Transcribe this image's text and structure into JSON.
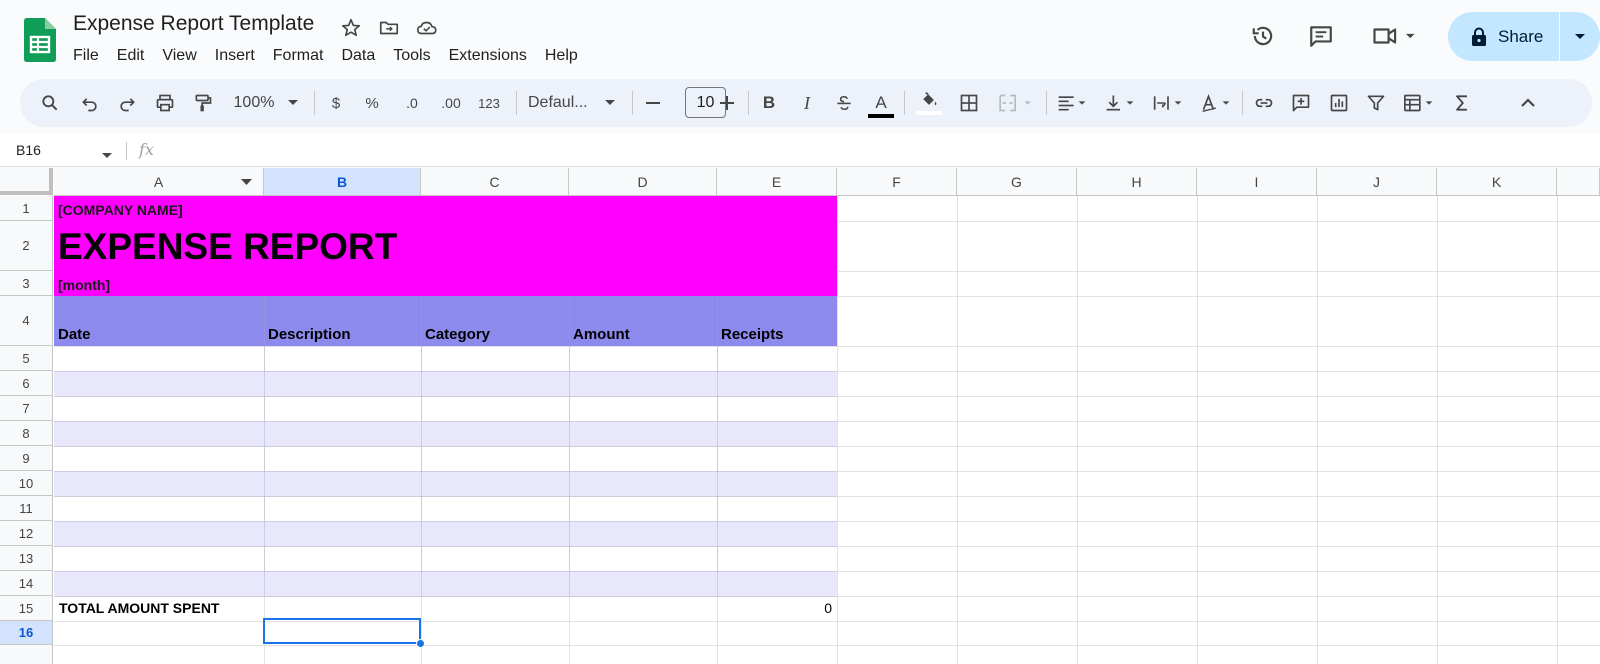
{
  "app": {
    "title": "Expense Report Template",
    "menus": [
      "File",
      "Edit",
      "View",
      "Insert",
      "Format",
      "Data",
      "Tools",
      "Extensions",
      "Help"
    ],
    "share_label": "Share"
  },
  "toolbar": {
    "zoom": "100%",
    "currency": "$",
    "percent": "%",
    "decrease_decimal": ".0",
    "increase_decimal": ".00",
    "format_more": "123",
    "font_name": "Defaul...",
    "font_size": "10",
    "bold": "B",
    "italic": "I",
    "text_color_glyph": "A"
  },
  "formula_bar": {
    "cell_ref": "B16",
    "fx": "fx",
    "value": ""
  },
  "sheet": {
    "columns": [
      "A",
      "B",
      "C",
      "D",
      "E",
      "F",
      "G",
      "H",
      "I",
      "J",
      "K"
    ],
    "selected_column": "B",
    "rows": [
      "1",
      "2",
      "3",
      "4",
      "5",
      "6",
      "7",
      "8",
      "9",
      "10",
      "11",
      "12",
      "13",
      "14",
      "15",
      "16"
    ],
    "selected_row": "16",
    "company_name": "[COMPANY NAME]",
    "report_title": "EXPENSE REPORT",
    "month": "[month]",
    "headers": [
      "Date",
      "Description",
      "Category",
      "Amount",
      "Receipts"
    ],
    "total_label": "TOTAL AMOUNT SPENT",
    "total_value": "0",
    "colors": {
      "title_band": "#ff00ff",
      "header_band": "#8c8aed",
      "stripe": "#e8e7fc",
      "selection": "#1a73e8"
    }
  }
}
